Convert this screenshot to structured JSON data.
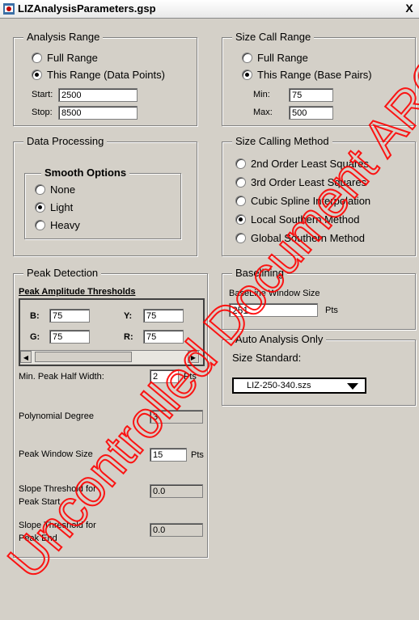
{
  "window": {
    "title": "LIZAnalysisParameters.gsp",
    "close_label": "X"
  },
  "analysis_range": {
    "legend": "Analysis Range",
    "options": [
      "Full Range",
      "This Range (Data Points)"
    ],
    "selected": "This Range (Data Points)",
    "start_label": "Start:",
    "start_value": "2500",
    "stop_label": "Stop:",
    "stop_value": "8500"
  },
  "size_call_range": {
    "legend": "Size Call Range",
    "options": [
      "Full Range",
      "This Range (Base Pairs)"
    ],
    "selected": "This Range (Base Pairs)",
    "min_label": "Min:",
    "min_value": "75",
    "max_label": "Max:",
    "max_value": "500"
  },
  "data_processing": {
    "legend": "Data Processing",
    "smooth_legend": "Smooth Options",
    "options": [
      "None",
      "Light",
      "Heavy"
    ],
    "selected": "Light"
  },
  "size_calling_method": {
    "legend": "Size Calling Method",
    "options": [
      "2nd Order Least Squares",
      "3rd Order Least Squares",
      "Cubic Spline Interpolation",
      "Local Southern Method",
      "Global Southern Method"
    ],
    "selected": "Local Southern Method"
  },
  "peak_detection": {
    "legend": "Peak Detection",
    "thresholds_label": "Peak Amplitude Thresholds",
    "b_label": "B:",
    "b_value": "75",
    "y_label": "Y:",
    "y_value": "75",
    "g_label": "G:",
    "g_value": "75",
    "r_label": "R:",
    "r_value": "75",
    "scroll_left": "◀",
    "scroll_right": "▶",
    "half_width_label": "Min. Peak Half Width:",
    "half_width_value": "2",
    "half_width_unit": "Pts",
    "poly_label": "Polynomial Degree",
    "poly_value": "3",
    "window_label": "Peak Window Size",
    "window_value": "15",
    "window_unit": "Pts",
    "slope_start_label_1": "Slope Threshold for",
    "slope_start_label_2": "Peak Start",
    "slope_start_value": "0.0",
    "slope_end_label_1": "Slope Threshold for",
    "slope_end_label_2": "Peak End",
    "slope_end_value": "0.0"
  },
  "baselining": {
    "legend": "Baselining",
    "window_label": "BaseLine Window Size",
    "window_value": "251",
    "window_unit": "Pts"
  },
  "auto_analysis": {
    "legend": "Auto Analysis Only",
    "size_standard_label": "Size Standard:",
    "size_standard_value": "LIZ-250-340.szs"
  },
  "watermark": {
    "text": "Uncontrolled Document ARCHIVE Copy",
    "color": "#ff0000"
  }
}
